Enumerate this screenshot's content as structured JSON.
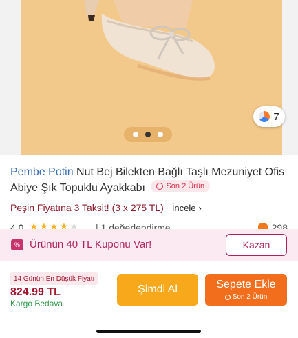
{
  "product": {
    "image_count_badge": "7",
    "carousel": {
      "pages": 3,
      "active_index": 1
    },
    "brand": "Pembe Potin",
    "title": " Nut Bej Bilekten Bağlı Taşlı Mezuniyet Ofis Abiye Şık Topuklu Ayakkabı",
    "stock_badge": "Son 2 Ürün",
    "installment_text": "Peşin Fiyatına 3 Taksit! (3 x 275 TL)",
    "installment_link": "İncele",
    "rating_value": "4.0",
    "rating_stars": 4,
    "review_text": "| 1 değerlendirme",
    "favorites_count": "298"
  },
  "coupon": {
    "icon": "coupon-icon",
    "text": "Ürünün 40 TL Kuponu Var!",
    "button": "Kazan"
  },
  "purchase_bar": {
    "lowest_price_badge": "14 Günün En Düşük Fiyatı",
    "price": "824.99 TL",
    "shipping": "Kargo Bedava",
    "buy_now": "Şimdi Al",
    "add_to_cart": "Sepete Ekle",
    "add_to_cart_sub": "Son 2 Ürün"
  },
  "colors": {
    "accent_orange": "#f26e1c",
    "buy_now": "#f8a91b",
    "coupon_bg": "#fbeaf1",
    "price_red": "#a3152d",
    "shipping_green": "#2e9a4a"
  }
}
